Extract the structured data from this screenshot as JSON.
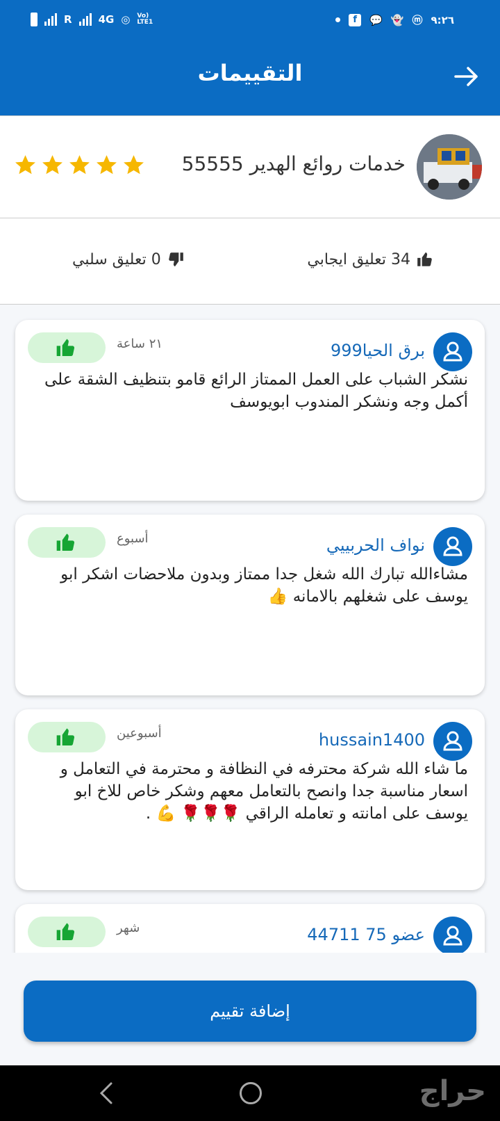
{
  "status_bar": {
    "left_text": "R",
    "network": "4G",
    "volte": "VoLTE1",
    "time": "٩:٢٦"
  },
  "appbar": {
    "title": "التقييمات",
    "back_icon": "arrow-right-icon"
  },
  "company": {
    "name": "خدمات روائع الهدير 55555",
    "rating_stars": 5,
    "star_color": "#f6b700"
  },
  "counts": {
    "positive": "34 تعليق ايجابي",
    "negative": "0 تعليق سلبي"
  },
  "reviews": [
    {
      "name": "برق الحيا999",
      "time": "٢١ ساعة",
      "text": "نشكر الشباب على العمل الممتاز الرائع قامو بتنظيف الشقة على أكمل وجه ونشكر المندوب ابويوسف"
    },
    {
      "name": "نواف الحربييي",
      "time": "أسبوع",
      "text": "مشاءالله تبارك الله شغل جدا ممتاز وبدون ملاحضات اشكر ابو يوسف على شغلهم بالامانه 👍"
    },
    {
      "name": "hussain1400",
      "time": "أسبوعين",
      "text": "ما شاء الله شركة محترفه في النظافة و محترمة في التعامل و اسعار مناسبة جدا  وانصح بالتعامل معهم وشكر خاص للاخ ابو يوسف على امانته و تعامله الراقي 🌹🌹🌹 💪 ."
    },
    {
      "name": "عضو 75 44711",
      "time": "شهر",
      "text": ""
    }
  ],
  "add_button": "إضافة تقييم",
  "watermark": "حراج",
  "colors": {
    "primary": "#0b6cc3",
    "like_bg": "#d7f5d9",
    "like_icon": "#16a534",
    "username": "#1669b8"
  }
}
